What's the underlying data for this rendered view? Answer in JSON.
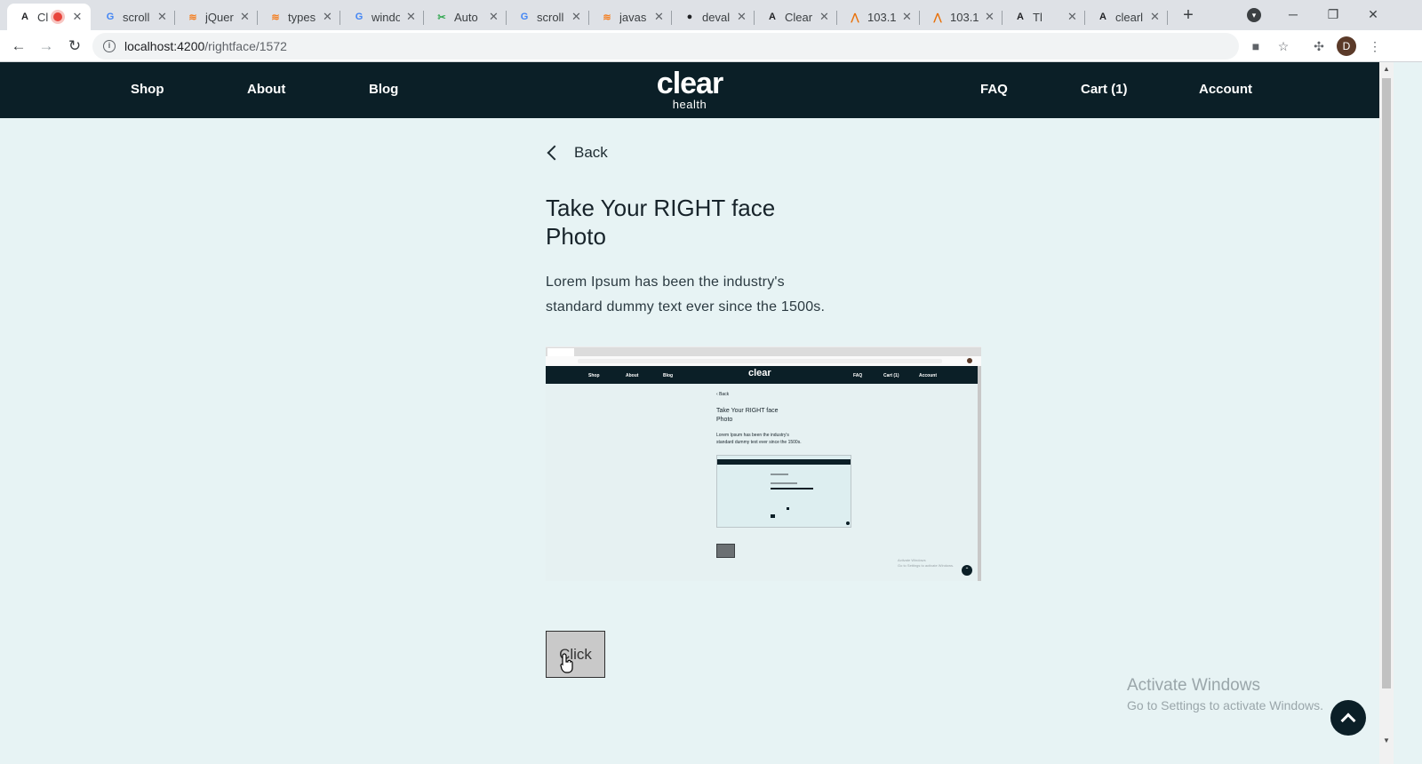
{
  "browser": {
    "tabs": [
      {
        "title": "Cl",
        "favicon": "angular-icon",
        "fav_color": "#202124",
        "fav_text": "A",
        "active": true,
        "recording": true
      },
      {
        "title": "scroll",
        "favicon": "google-icon",
        "fav_color": "#4285f4",
        "fav_text": "G"
      },
      {
        "title": "jQuer",
        "favicon": "stackoverflow-icon",
        "fav_color": "#f48024",
        "fav_text": "≋"
      },
      {
        "title": "types",
        "favicon": "stackoverflow-icon",
        "fav_color": "#f48024",
        "fav_text": "≋"
      },
      {
        "title": "windo",
        "favicon": "google-icon",
        "fav_color": "#4285f4",
        "fav_text": "G"
      },
      {
        "title": "Auto",
        "favicon": "tool-icon",
        "fav_color": "#34a853",
        "fav_text": "✂"
      },
      {
        "title": "scroll",
        "favicon": "google-icon",
        "fav_color": "#4285f4",
        "fav_text": "G"
      },
      {
        "title": "javas",
        "favicon": "stackoverflow-icon",
        "fav_color": "#f48024",
        "fav_text": "≋"
      },
      {
        "title": "devall",
        "favicon": "github-icon",
        "fav_color": "#202124",
        "fav_text": "●"
      },
      {
        "title": "Clearl",
        "favicon": "angular-icon",
        "fav_color": "#202124",
        "fav_text": "A"
      },
      {
        "title": "103.1",
        "favicon": "pma-icon",
        "fav_color": "#e8710a",
        "fav_text": "⋀"
      },
      {
        "title": "103.1",
        "favicon": "pma-icon",
        "fav_color": "#e8710a",
        "fav_text": "⋀"
      },
      {
        "title": "Tl",
        "favicon": "angular-icon",
        "fav_color": "#202124",
        "fav_text": "A"
      },
      {
        "title": "clearl",
        "favicon": "angular-icon",
        "fav_color": "#202124",
        "fav_text": "A"
      }
    ],
    "url_host": "localhost:4200",
    "url_path": "/rightface/1572",
    "profile_initial": "D"
  },
  "site": {
    "nav_left": [
      "Shop",
      "About",
      "Blog"
    ],
    "logo_main": "clear",
    "logo_sub": "health",
    "nav_right": [
      "FAQ",
      "Cart (1)",
      "Account"
    ]
  },
  "main": {
    "back_label": "Back",
    "title": "Take Your RIGHT face Photo",
    "description": "Lorem Ipsum has been the industry's standard dummy text ever since the 1500s.",
    "click_label": "Click"
  },
  "preview": {
    "nav_left": [
      "Shop",
      "About",
      "Blog"
    ],
    "nav_right": [
      "FAQ",
      "Cart (1)",
      "Account"
    ],
    "logo": "clear",
    "back": "Back",
    "title_line1": "Take Your RIGHT face",
    "title_line2": "Photo",
    "desc_line1": "Lorem Ipsum has been the industry's",
    "desc_line2": "standard dummy text ever since the 1500s.",
    "watermark_line1": "Activate Windows",
    "watermark_line2": "Go to Settings to activate Windows."
  },
  "os_overlay": {
    "activate_title": "Activate Windows",
    "activate_sub": "Go to Settings to activate Windows."
  },
  "colors": {
    "header_bg": "#0b1f27",
    "page_bg": "#e7f3f4",
    "button_bg": "#c9c9c9"
  }
}
